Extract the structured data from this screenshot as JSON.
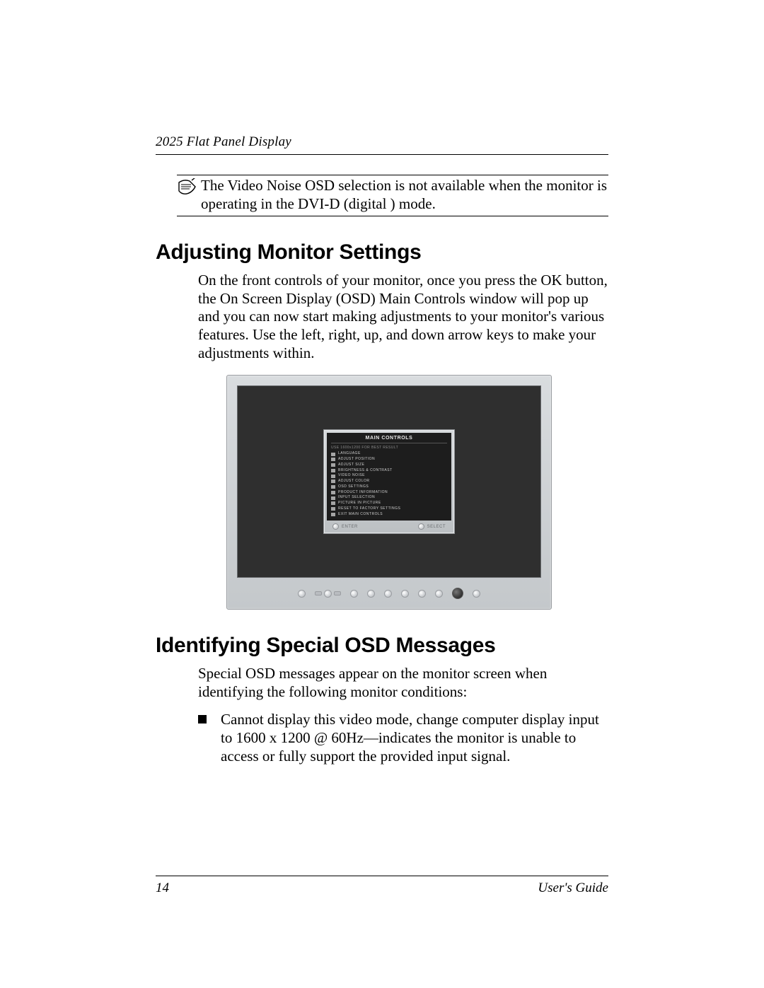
{
  "header": {
    "product": "2025 Flat Panel Display"
  },
  "note": {
    "text": "The Video Noise OSD selection is not available when the monitor is operating in the DVI-D (digital ) mode."
  },
  "sections": {
    "adjusting": {
      "heading": "Adjusting Monitor Settings",
      "body": "On the front controls of your monitor, once you press the OK button, the On Screen Display (OSD) Main Controls window will pop up and you can now start making adjustments to your monitor's various features. Use the left, right, up, and down arrow keys to make your adjustments within."
    },
    "identifying": {
      "heading": "Identifying Special OSD Messages",
      "body": "Special OSD messages appear on the monitor screen when identifying the following monitor conditions:",
      "bullets": [
        "Cannot display this video mode, change computer display input to 1600 x 1200 @ 60Hz—indicates the monitor is unable to access or fully support the provided input signal."
      ]
    }
  },
  "osd": {
    "title": "MAIN CONTROLS",
    "hint": "USE 1600x1200 FOR BEST RESULT",
    "items": [
      "LANGUAGE",
      "ADJUST POSITION",
      "ADJUST SIZE",
      "BRIGHTNESS & CONTRAST",
      "VIDEO NOISE",
      "ADJUST COLOR",
      "OSD SETTINGS",
      "PRODUCT INFORMATION",
      "INPUT SELECTION",
      "PICTURE IN PICTURE",
      "RESET TO FACTORY SETTINGS",
      "EXIT MAIN CONTROLS"
    ],
    "footer_left": "ENTER",
    "footer_right": "SELECT"
  },
  "footer": {
    "page": "14",
    "doc": "User's Guide"
  }
}
